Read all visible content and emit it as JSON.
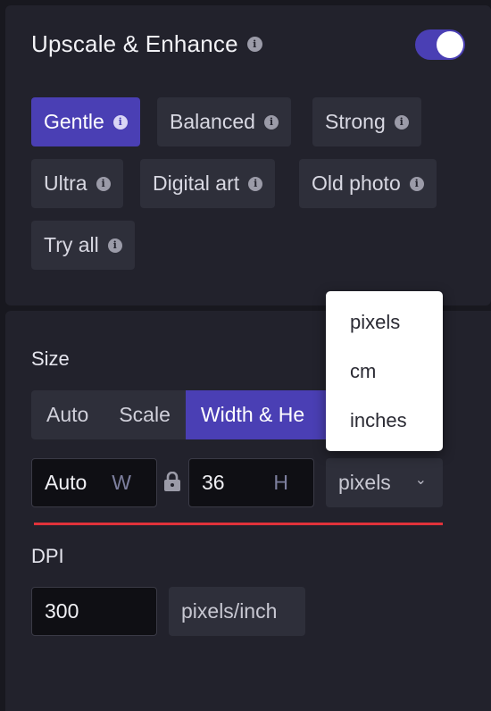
{
  "upscale": {
    "title": "Upscale & Enhance",
    "enabled": true,
    "modes": [
      {
        "label": "Gentle",
        "active": true
      },
      {
        "label": "Balanced",
        "active": false
      },
      {
        "label": "Strong",
        "active": false
      },
      {
        "label": "Ultra",
        "active": false
      },
      {
        "label": "Digital art",
        "active": false
      },
      {
        "label": "Old photo",
        "active": false
      },
      {
        "label": "Try all",
        "active": false
      }
    ]
  },
  "size": {
    "label": "Size",
    "tabs": [
      {
        "label": "Auto",
        "active": false
      },
      {
        "label": "Scale",
        "active": false
      },
      {
        "label": "Width & He",
        "active": true
      }
    ],
    "width_value": "Auto",
    "width_suffix": "W",
    "height_value": "36",
    "height_suffix": "H",
    "unit_selected": "pixels",
    "unit_options": [
      "pixels",
      "cm",
      "inches"
    ]
  },
  "dpi": {
    "label": "DPI",
    "value": "300",
    "unit": "pixels/inch"
  },
  "icons": {
    "info": "info-icon",
    "lock": "lock-icon",
    "chevron": "chevron-down-icon"
  },
  "colors": {
    "accent": "#4a3fb4",
    "panel": "#22222c",
    "background": "#18181f",
    "chip": "#2e2f3a",
    "error_line": "#e0323a"
  }
}
